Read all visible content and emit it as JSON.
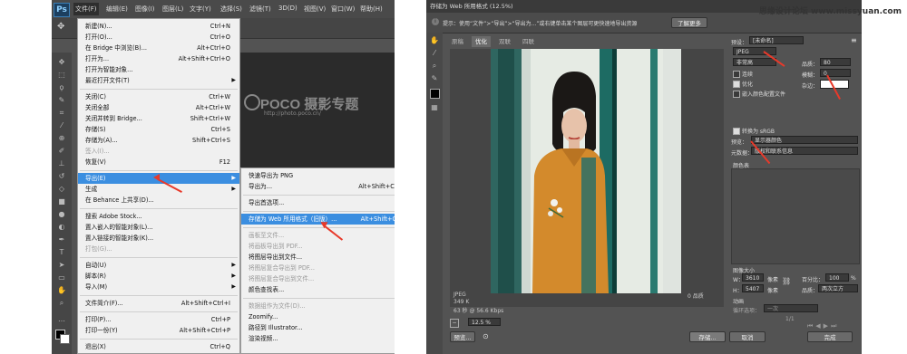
{
  "left": {
    "app_logo": "Ps",
    "menubar": [
      "文件(F)",
      "编辑(E)",
      "图像(I)",
      "图层(L)",
      "文字(Y)",
      "选择(S)",
      "滤镜(T)",
      "3D(D)",
      "视图(V)",
      "窗口(W)",
      "帮助(H)"
    ],
    "watermark": {
      "brand": "POCO 摄影专题",
      "url": "http://photo.poco.cn/"
    },
    "file_menu": [
      {
        "label": "新建(N)...",
        "shortcut": "Ctrl+N"
      },
      {
        "label": "打开(O)...",
        "shortcut": "Ctrl+O"
      },
      {
        "label": "在 Bridge 中浏览(B)...",
        "shortcut": "Alt+Ctrl+O"
      },
      {
        "label": "打开为...",
        "shortcut": "Alt+Shift+Ctrl+O"
      },
      {
        "label": "打开为智能对象...",
        "shortcut": ""
      },
      {
        "label": "最近打开文件(T)",
        "shortcut": ""
      },
      {
        "label": "关闭(C)",
        "shortcut": "Ctrl+W"
      },
      {
        "label": "关闭全部",
        "shortcut": "Alt+Ctrl+W"
      },
      {
        "label": "关闭并转到 Bridge...",
        "shortcut": "Shift+Ctrl+W"
      },
      {
        "label": "存储(S)",
        "shortcut": "Ctrl+S"
      },
      {
        "label": "存储为(A)...",
        "shortcut": "Shift+Ctrl+S"
      },
      {
        "label": "签入(I)...",
        "shortcut": ""
      },
      {
        "label": "恢复(V)",
        "shortcut": "F12"
      },
      {
        "label": "导出(E)",
        "shortcut": ""
      },
      {
        "label": "生成",
        "shortcut": ""
      },
      {
        "label": "在 Behance 上共享(D)...",
        "shortcut": ""
      },
      {
        "label": "搜索 Adobe Stock...",
        "shortcut": ""
      },
      {
        "label": "置入嵌入的智能对象(L)...",
        "shortcut": ""
      },
      {
        "label": "置入链接的智能对象(K)...",
        "shortcut": ""
      },
      {
        "label": "打包(G)...",
        "shortcut": ""
      },
      {
        "label": "自动(U)",
        "shortcut": ""
      },
      {
        "label": "脚本(R)",
        "shortcut": ""
      },
      {
        "label": "导入(M)",
        "shortcut": ""
      },
      {
        "label": "文件简介(F)...",
        "shortcut": "Alt+Shift+Ctrl+I"
      },
      {
        "label": "打印(P)...",
        "shortcut": "Ctrl+P"
      },
      {
        "label": "打印一份(Y)",
        "shortcut": "Alt+Shift+Ctrl+P"
      },
      {
        "label": "退出(X)",
        "shortcut": "Ctrl+Q"
      }
    ],
    "export_submenu": [
      {
        "label": "快速导出为 PNG",
        "shortcut": ""
      },
      {
        "label": "导出为...",
        "shortcut": "Alt+Shift+Ctrl+W"
      },
      {
        "label": "导出首选项...",
        "shortcut": ""
      },
      {
        "label": "存储为 Web 所用格式（旧版）...",
        "shortcut": "Alt+Shift+Ctrl+S"
      },
      {
        "label": "画板至文件...",
        "shortcut": ""
      },
      {
        "label": "将画板导出到 PDF...",
        "shortcut": ""
      },
      {
        "label": "将图层导出到文件...",
        "shortcut": ""
      },
      {
        "label": "将图层复合导出到 PDF...",
        "shortcut": ""
      },
      {
        "label": "将图层复合导出到文件...",
        "shortcut": ""
      },
      {
        "label": "颜色查找表...",
        "shortcut": ""
      },
      {
        "label": "数据组作为文件(D)...",
        "shortcut": ""
      },
      {
        "label": "Zoomify...",
        "shortcut": ""
      },
      {
        "label": "路径到 Illustrator...",
        "shortcut": ""
      },
      {
        "label": "渲染视频...",
        "shortcut": ""
      }
    ]
  },
  "right": {
    "title": "存储为 Web 所用格式 (12.5%)",
    "tip": "提示：使用“文件”>“导出”>“导出为...”或右键单击某个图层可更快速地导出资源",
    "learn_more": "了解更多",
    "tabs": [
      "原稿",
      "优化",
      "双联",
      "四联"
    ],
    "preset_label": "预设：",
    "preset_value": "[未命名]",
    "format_value": "JPEG",
    "quality_level": "非常高",
    "quality_label": "品质：",
    "quality_value": "80",
    "progressive_label": "连续",
    "blur_label": "模糊：",
    "blur_value": "0",
    "optimized_label": "优化",
    "matte_label": "杂边：",
    "embed_profile_label": "嵌入颜色配置文件",
    "convert_srgb_label": "转换为 sRGB",
    "preview_label": "预览：",
    "preview_value": "显示器颜色",
    "metadata_label": "元数据：",
    "metadata_value": "版权和联系信息",
    "color_table_label": "颜色表",
    "preview_format": "JPEG",
    "preview_size": "349 K",
    "preview_time": "63 秒 @ 56.6 Kbps",
    "preview_quality": "0 品质",
    "image_size_label": "图像大小",
    "width_label": "W：",
    "width_value": "3610",
    "height_label": "H：",
    "height_value": "5407",
    "unit_px": "像素",
    "percent_label": "百分比：",
    "percent_value": "100",
    "percent_unit": "%",
    "quality_resample_label": "品质：",
    "quality_resample_value": "两次立方",
    "animation_label": "动画",
    "loop_label": "循环选项：",
    "loop_value": "一次",
    "frame_counter": "1/1",
    "zoom_value": "12.5 %",
    "preview_button": "预览...",
    "save_button": "存储...",
    "cancel_button": "取消",
    "done_button": "完成"
  },
  "colors": {
    "arrow": "#e8392a",
    "menu_highlight": "#3b8ee0",
    "ps_blue": "#1c3f5f"
  }
}
